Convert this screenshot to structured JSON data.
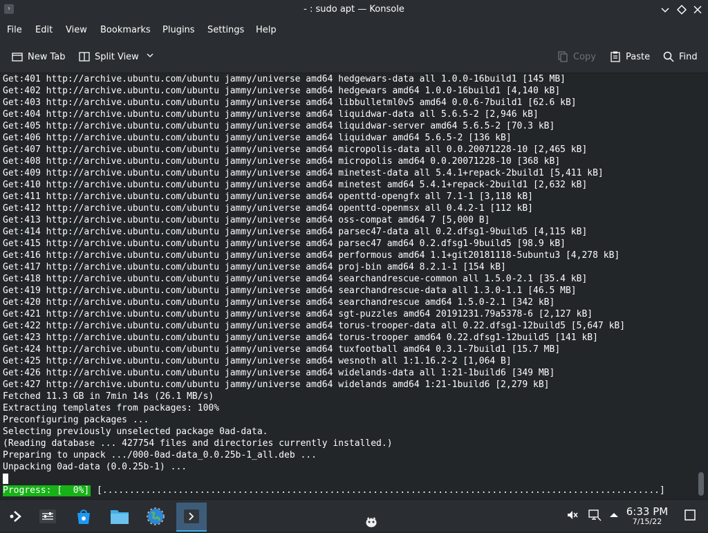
{
  "window": {
    "title": "- : sudo apt — Konsole",
    "app_icon": "terminal-icon",
    "controls": [
      "minimize-icon",
      "maximize-icon",
      "close-icon"
    ]
  },
  "menu": {
    "items": [
      "File",
      "Edit",
      "View",
      "Bookmarks",
      "Plugins",
      "Settings",
      "Help"
    ]
  },
  "toolbar": {
    "new_tab": "New Tab",
    "split_view": "Split View",
    "copy": "Copy",
    "paste": "Paste",
    "find": "Find"
  },
  "terminal": {
    "lines": [
      "Get:401 http://archive.ubuntu.com/ubuntu jammy/universe amd64 hedgewars-data all 1.0.0-16build1 [145 MB]",
      "Get:402 http://archive.ubuntu.com/ubuntu jammy/universe amd64 hedgewars amd64 1.0.0-16build1 [4,140 kB]",
      "Get:403 http://archive.ubuntu.com/ubuntu jammy/universe amd64 libbulletml0v5 amd64 0.0.6-7build1 [62.6 kB]",
      "Get:404 http://archive.ubuntu.com/ubuntu jammy/universe amd64 liquidwar-data all 5.6.5-2 [2,946 kB]",
      "Get:405 http://archive.ubuntu.com/ubuntu jammy/universe amd64 liquidwar-server amd64 5.6.5-2 [70.3 kB]",
      "Get:406 http://archive.ubuntu.com/ubuntu jammy/universe amd64 liquidwar amd64 5.6.5-2 [136 kB]",
      "Get:407 http://archive.ubuntu.com/ubuntu jammy/universe amd64 micropolis-data all 0.0.20071228-10 [2,465 kB]",
      "Get:408 http://archive.ubuntu.com/ubuntu jammy/universe amd64 micropolis amd64 0.0.20071228-10 [368 kB]",
      "Get:409 http://archive.ubuntu.com/ubuntu jammy/universe amd64 minetest-data all 5.4.1+repack-2build1 [5,411 kB]",
      "Get:410 http://archive.ubuntu.com/ubuntu jammy/universe amd64 minetest amd64 5.4.1+repack-2build1 [2,632 kB]",
      "Get:411 http://archive.ubuntu.com/ubuntu jammy/universe amd64 openttd-opengfx all 7.1-1 [3,118 kB]",
      "Get:412 http://archive.ubuntu.com/ubuntu jammy/universe amd64 openttd-openmsx all 0.4.2-1 [112 kB]",
      "Get:413 http://archive.ubuntu.com/ubuntu jammy/universe amd64 oss-compat amd64 7 [5,000 B]",
      "Get:414 http://archive.ubuntu.com/ubuntu jammy/universe amd64 parsec47-data all 0.2.dfsg1-9build5 [4,115 kB]",
      "Get:415 http://archive.ubuntu.com/ubuntu jammy/universe amd64 parsec47 amd64 0.2.dfsg1-9build5 [98.9 kB]",
      "Get:416 http://archive.ubuntu.com/ubuntu jammy/universe amd64 performous amd64 1.1+git20181118-5ubuntu3 [4,278 kB]",
      "Get:417 http://archive.ubuntu.com/ubuntu jammy/universe amd64 proj-bin amd64 8.2.1-1 [154 kB]",
      "Get:418 http://archive.ubuntu.com/ubuntu jammy/universe amd64 searchandrescue-common all 1.5.0-2.1 [35.4 kB]",
      "Get:419 http://archive.ubuntu.com/ubuntu jammy/universe amd64 searchandrescue-data all 1.3.0-1.1 [46.5 MB]",
      "Get:420 http://archive.ubuntu.com/ubuntu jammy/universe amd64 searchandrescue amd64 1.5.0-2.1 [342 kB]",
      "Get:421 http://archive.ubuntu.com/ubuntu jammy/universe amd64 sgt-puzzles amd64 20191231.79a5378-6 [2,127 kB]",
      "Get:422 http://archive.ubuntu.com/ubuntu jammy/universe amd64 torus-trooper-data all 0.22.dfsg1-12build5 [5,647 kB]",
      "Get:423 http://archive.ubuntu.com/ubuntu jammy/universe amd64 torus-trooper amd64 0.22.dfsg1-12build5 [141 kB]",
      "Get:424 http://archive.ubuntu.com/ubuntu jammy/universe amd64 tuxfootball amd64 0.3.1-7build1 [15.7 MB]",
      "Get:425 http://archive.ubuntu.com/ubuntu jammy/universe amd64 wesnoth all 1:1.16.2-2 [1,064 B]",
      "Get:426 http://archive.ubuntu.com/ubuntu jammy/universe amd64 widelands-data all 1:21-1build6 [349 MB]",
      "Get:427 http://archive.ubuntu.com/ubuntu jammy/universe amd64 widelands amd64 1:21-1build6 [2,279 kB]",
      "Fetched 11.3 GB in 7min 14s (26.1 MB/s)",
      "Extracting templates from packages: 100%",
      "Preconfiguring packages ...",
      "Selecting previously unselected package 0ad-data.",
      "(Reading database ... 427754 files and directories currently installed.)",
      "Preparing to unpack .../000-0ad-data_0.0.25b-1_all.deb ...",
      "Unpacking 0ad-data (0.0.25b-1) ..."
    ],
    "progress_label": "Progress: [  0%]",
    "progress_percent": 0,
    "progress_bar": "[.......................................................................................................]"
  },
  "taskbar": {
    "launchers": [
      "app-launcher-icon",
      "system-settings-icon",
      "discover-store-icon",
      "file-manager-icon",
      "web-browser-icon",
      "konsole-icon"
    ],
    "tray": [
      "mute-icon",
      "network-icon",
      "expand-tray-icon"
    ],
    "time": "6:33 PM",
    "date": "7/15/22",
    "show_desktop": "show-desktop-icon"
  },
  "colors": {
    "background": "#232629",
    "chrome": "#2a2e32",
    "text": "#fcfcfc",
    "progress_green": "#18b218",
    "accent": "#3daee9"
  }
}
